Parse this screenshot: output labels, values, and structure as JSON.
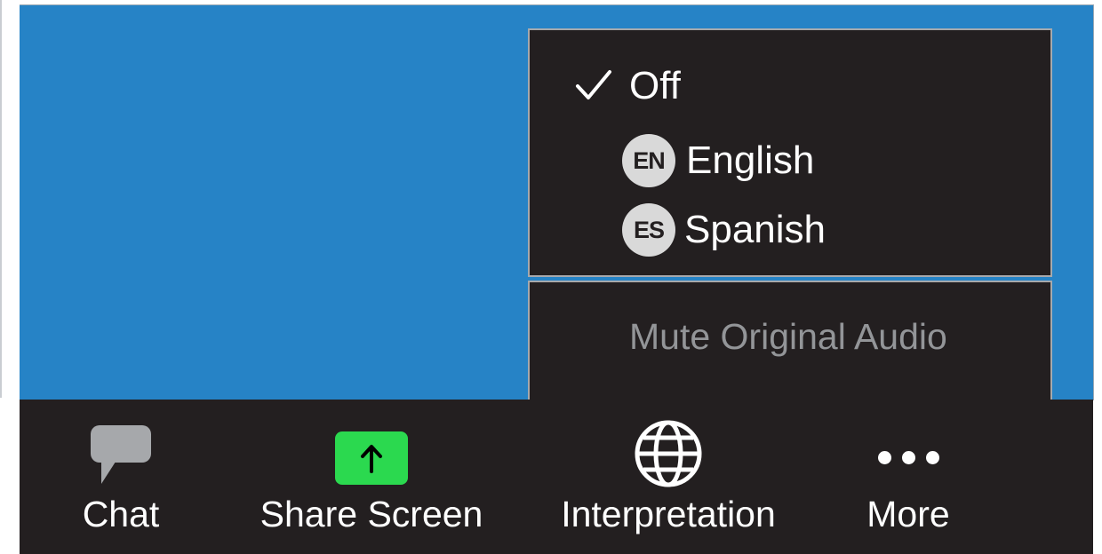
{
  "interpretation_menu": {
    "items": [
      {
        "label": "Off",
        "checked": true,
        "badge": ""
      },
      {
        "label": "English",
        "checked": false,
        "badge": "EN"
      },
      {
        "label": "Spanish",
        "checked": false,
        "badge": "ES"
      }
    ],
    "mute_original_audio_label": "Mute Original Audio"
  },
  "toolbar": {
    "items": [
      {
        "label": "Chat",
        "icon": "chat-bubble-icon"
      },
      {
        "label": "Share Screen",
        "icon": "share-screen-icon"
      },
      {
        "label": "Interpretation",
        "icon": "globe-icon"
      },
      {
        "label": "More",
        "icon": "more-dots-icon"
      }
    ]
  },
  "colors": {
    "meeting_background": "#2683c6",
    "panel_background": "#231f20",
    "share_green": "#2bd94f",
    "disabled_text": "#939598"
  }
}
